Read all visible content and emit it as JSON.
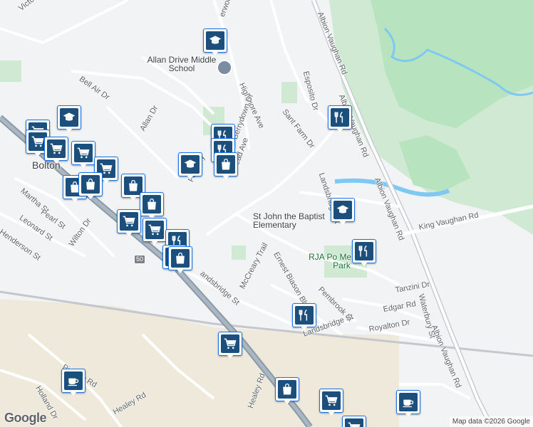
{
  "map": {
    "colors": {
      "land": "#f1f3f4",
      "park": "#cfe9d2",
      "wood": "#b7e3bf",
      "water": "#7ec8f2",
      "road": "#ffffff",
      "highway": "#8a9aa8",
      "rail": "#c4c7cc",
      "industrial": "#ece4d0",
      "marker": "#1c4f7c",
      "marker_border": "#1a73e8"
    },
    "labels": {
      "victoria": "Victoria St",
      "sherwood": "erwood Ter",
      "allan_drive_school": "Allan Drive Middle School",
      "bell_air": "Bell Air Dr",
      "highmore": "Highmore Ave",
      "esposito": "Esposito Dr",
      "albion_vaughan_top": "Albion Vaughan Rd",
      "albion_vaughan_mid": "Albion Vaughan Rd",
      "albion_vaughan_low": "Albion Vaughan Rd",
      "sant_farm": "Sant Farm Dr",
      "allan_dr": "Allan Dr",
      "berrydown": "Berrydown Dr",
      "foundry": "Foundry",
      "shortbread": "tbread Ave",
      "landsbridge_top": "Landsbridge St",
      "bolton": "Bolton",
      "martha": "Martha St",
      "pearl": "Pearl St",
      "leonard": "Leonard St",
      "henderson": "Henderson St",
      "wilton": "Wilton Dr",
      "st_john": "St John the Baptist Elementary",
      "king_vaughan": "King Vaughan Rd",
      "hwy50": "50",
      "rja_park": "RJA Po Memorial Park",
      "landsbridge_left": "andsbridge St",
      "mccreary": "McCreary Trail",
      "ernest_biason": "Ernest Biason Blvd",
      "pembrook": "Pembrook St",
      "tanzini": "Tanzini Dr",
      "edgar": "Edgar Rd",
      "waterbury": "Waterbury St",
      "royalton": "Royalton Dr",
      "landsbridge_low": "Landsbridge St",
      "piercey": "Piercey Rd",
      "holland": "Holland Dr",
      "healey_left": "Healey Rd",
      "healey_right": "Healey Rd"
    },
    "markers": [
      {
        "icon": "school-icon",
        "name": "marker-allan-drive-school"
      },
      {
        "icon": "school-icon",
        "name": "marker-school-bolton"
      },
      {
        "icon": "restaurant-icon",
        "name": "marker-restaurant-1"
      },
      {
        "icon": "restaurant-icon",
        "name": "marker-restaurant-2"
      },
      {
        "icon": "restaurant-icon",
        "name": "marker-restaurant-3"
      },
      {
        "icon": "school-icon",
        "name": "marker-school-foundry"
      },
      {
        "icon": "shopping-bag-icon",
        "name": "marker-shopping-1"
      },
      {
        "icon": "school-icon",
        "name": "marker-st-john-school"
      },
      {
        "icon": "restaurant-icon",
        "name": "marker-restaurant-rja"
      },
      {
        "icon": "restaurant-icon",
        "name": "marker-restaurant-landsbridge"
      },
      {
        "icon": "shopping-cart-icon",
        "name": "marker-grocery-1"
      },
      {
        "icon": "shopping-cart-icon",
        "name": "marker-grocery-2"
      },
      {
        "icon": "shopping-cart-icon",
        "name": "marker-grocery-3"
      },
      {
        "icon": "shopping-cart-icon",
        "name": "marker-grocery-4"
      },
      {
        "icon": "shopping-bag-icon",
        "name": "marker-shopping-2"
      },
      {
        "icon": "shopping-bag-icon",
        "name": "marker-shopping-3"
      },
      {
        "icon": "shopping-bag-icon",
        "name": "marker-shopping-4"
      },
      {
        "icon": "shopping-cart-icon",
        "name": "marker-grocery-5"
      },
      {
        "icon": "shopping-cart-icon",
        "name": "marker-grocery-6"
      },
      {
        "icon": "restaurant-icon",
        "name": "marker-restaurant-4"
      },
      {
        "icon": "shopping-bag-icon",
        "name": "marker-shopping-5"
      },
      {
        "icon": "shopping-bag-icon",
        "name": "marker-shopping-6"
      },
      {
        "icon": "shopping-cart-icon",
        "name": "marker-grocery-7"
      },
      {
        "icon": "shopping-bag-icon",
        "name": "marker-shopping-7"
      },
      {
        "icon": "shopping-bag-icon",
        "name": "marker-shopping-8"
      },
      {
        "icon": "shopping-cart-icon",
        "name": "marker-grocery-8"
      },
      {
        "icon": "cafe-icon",
        "name": "marker-cafe-1"
      },
      {
        "icon": "cafe-icon",
        "name": "marker-cafe-2"
      },
      {
        "icon": "shopping-cart-icon",
        "name": "marker-grocery-9"
      },
      {
        "icon": "shopping-cart-icon",
        "name": "marker-grocery-10"
      }
    ],
    "logo": "Google",
    "attribution": "Map data ©2026 Google"
  }
}
